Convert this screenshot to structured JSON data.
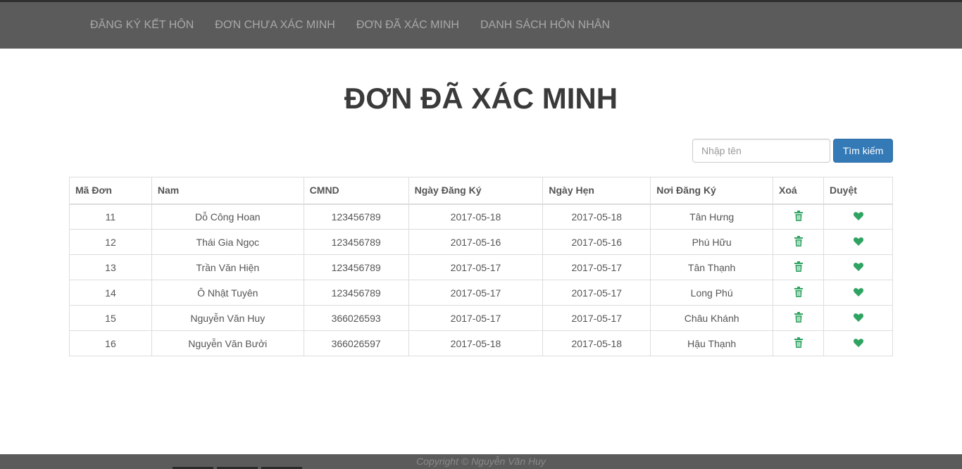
{
  "nav": {
    "items": [
      {
        "label": "ĐĂNG KÝ KẾT HÔN"
      },
      {
        "label": "ĐƠN CHƯA XÁC MINH"
      },
      {
        "label": "ĐƠN ĐÃ XÁC MINH"
      },
      {
        "label": "DANH SÁCH HÔN NHÂN"
      }
    ]
  },
  "page": {
    "title": "ĐƠN ĐÃ XÁC MINH"
  },
  "search": {
    "placeholder": "Nhập tên",
    "value": "",
    "button_label": "Tìm kiếm"
  },
  "table": {
    "headers": [
      "Mã Đơn",
      "Nam",
      "CMND",
      "Ngày Đăng Ký",
      "Ngày Hẹn",
      "Nơi Đăng Ký",
      "Xoá",
      "Duyệt"
    ],
    "rows": [
      {
        "id": "11",
        "name": "Dỗ Công Hoan",
        "cmnd": "123456789",
        "reg_date": "2017-05-18",
        "appt_date": "2017-05-18",
        "place": "Tân Hưng"
      },
      {
        "id": "12",
        "name": "Thái Gia Ngọc",
        "cmnd": "123456789",
        "reg_date": "2017-05-16",
        "appt_date": "2017-05-16",
        "place": "Phú Hữu"
      },
      {
        "id": "13",
        "name": "Trần Văn Hiện",
        "cmnd": "123456789",
        "reg_date": "2017-05-17",
        "appt_date": "2017-05-17",
        "place": "Tân Thạnh"
      },
      {
        "id": "14",
        "name": "Ô Nhật Tuyên",
        "cmnd": "123456789",
        "reg_date": "2017-05-17",
        "appt_date": "2017-05-17",
        "place": "Long Phú"
      },
      {
        "id": "15",
        "name": "Nguyễn Văn Huy",
        "cmnd": "366026593",
        "reg_date": "2017-05-17",
        "appt_date": "2017-05-17",
        "place": "Châu Khánh"
      },
      {
        "id": "16",
        "name": "Nguyễn Văn Bưởi",
        "cmnd": "366026597",
        "reg_date": "2017-05-18",
        "appt_date": "2017-05-18",
        "place": "Hậu Thạnh"
      }
    ],
    "delete_icon": "trash-icon",
    "approve_icon": "heart-icon"
  },
  "colors": {
    "navbar": "#5b5b5b",
    "nav_text": "#a8a8a8",
    "primary_button": "#337ab7",
    "icon_green": "#2fa362"
  },
  "footer": {
    "text": "Copyright © Nguyễn Văn Huy"
  }
}
